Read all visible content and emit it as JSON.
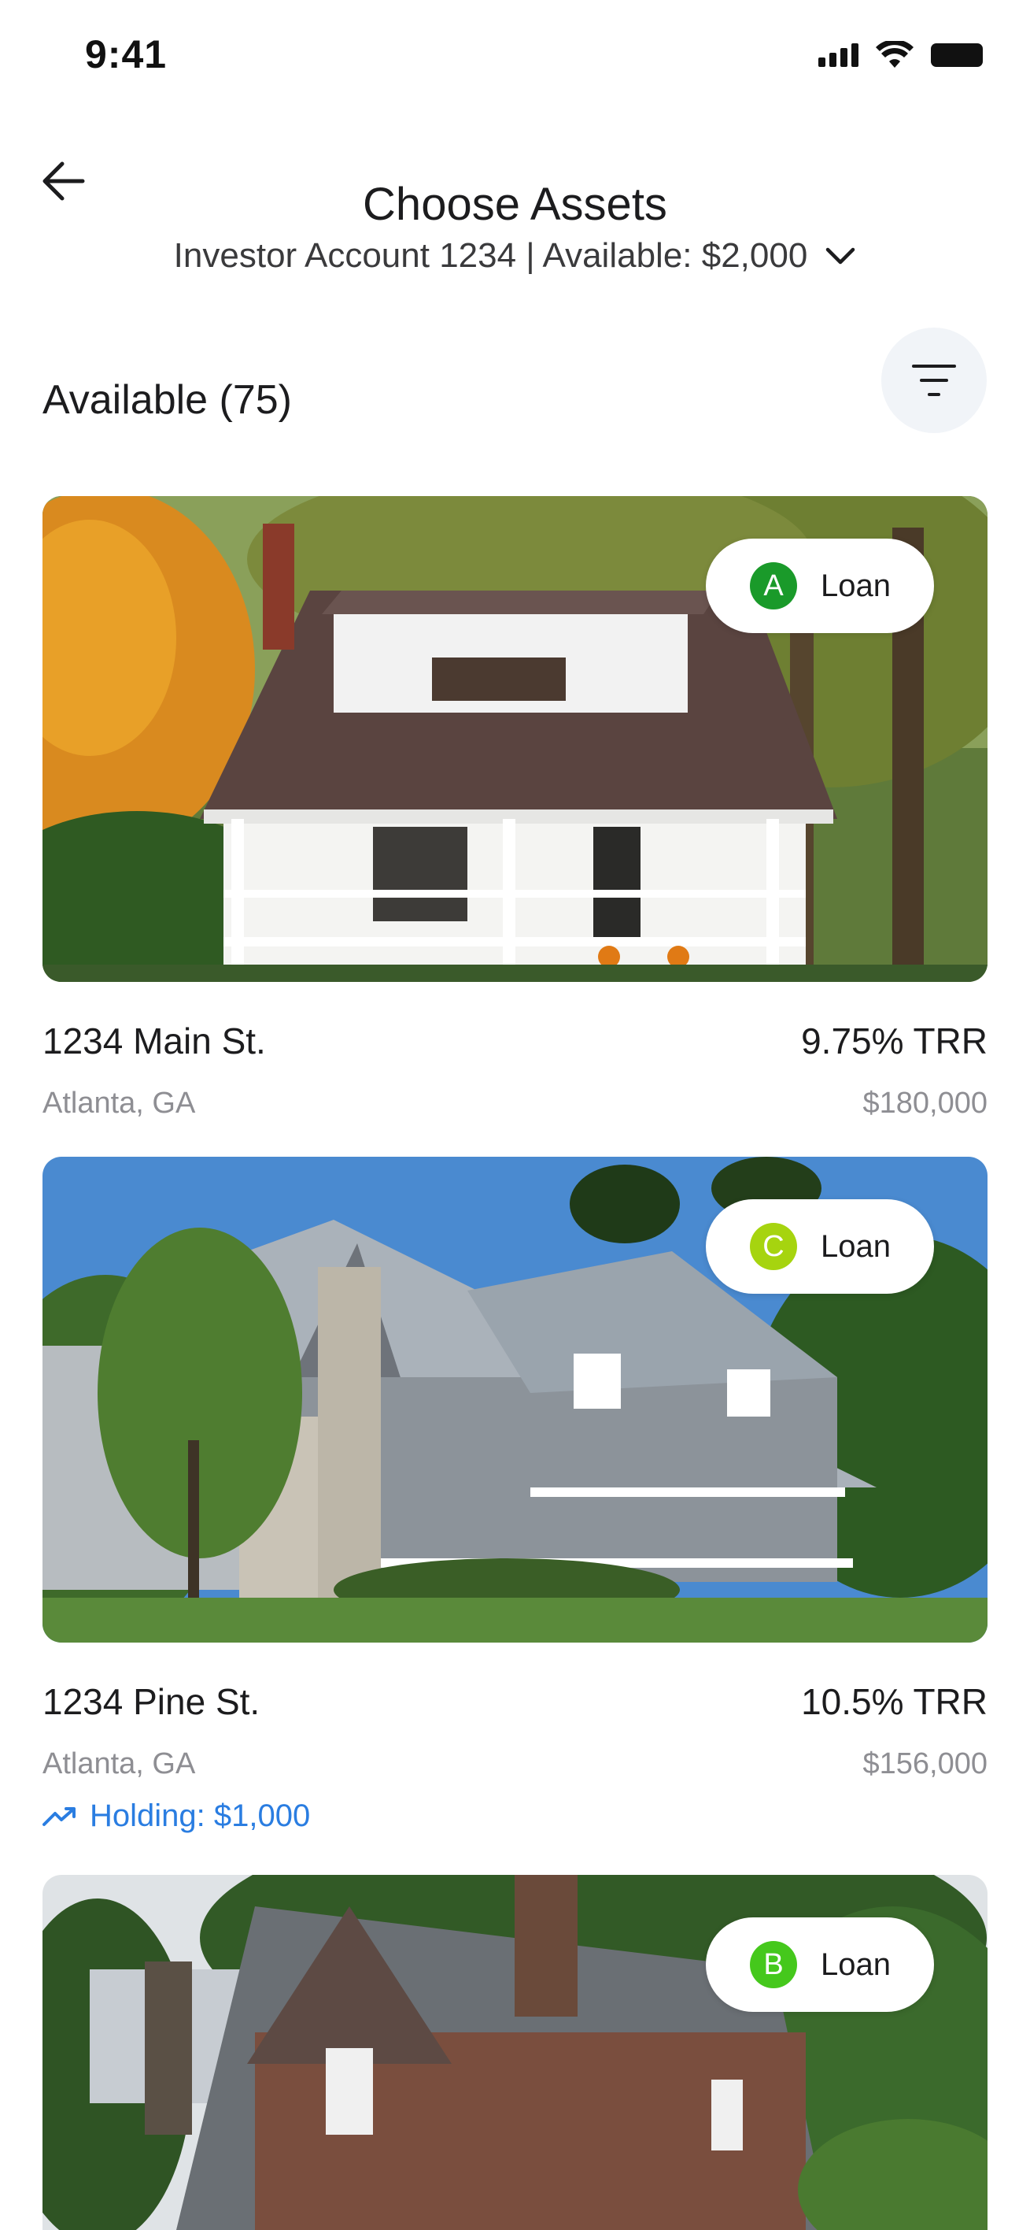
{
  "status_bar": {
    "time": "9:41"
  },
  "header": {
    "title": "Choose Assets",
    "account": "Investor Account 1234 | Available: $2,000"
  },
  "section": {
    "title": "Available (75)"
  },
  "colors": {
    "accent": "#2a7de1",
    "grade_a": "#1a9a2a",
    "grade_b": "#45c81c",
    "grade_c": "#a6d40f"
  },
  "assets": [
    {
      "address": "1234 Main St.",
      "city": "Atlanta, GA",
      "trr": "9.75% TRR",
      "price": "$180,000",
      "grade": "A",
      "type": "Loan"
    },
    {
      "address": "1234 Pine St.",
      "city": "Atlanta, GA",
      "trr": "10.5% TRR",
      "price": "$156,000",
      "grade": "C",
      "type": "Loan",
      "holding": "Holding: $1,000"
    },
    {
      "grade": "B",
      "type": "Loan"
    }
  ]
}
